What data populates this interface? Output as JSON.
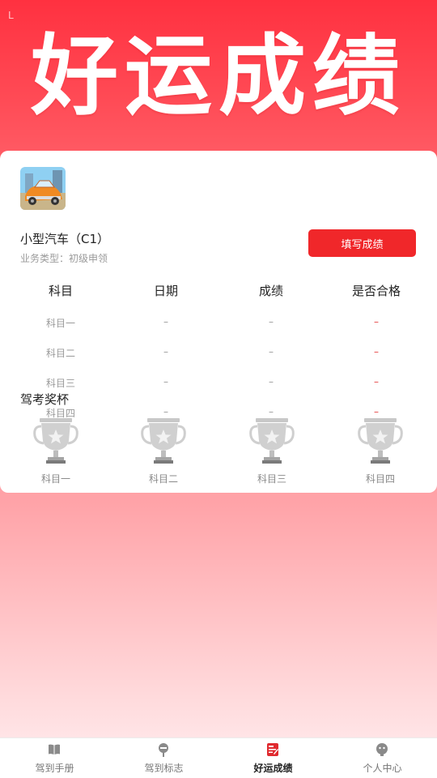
{
  "status": {
    "indicator": "L"
  },
  "hero": {
    "title": "好运成绩"
  },
  "license": {
    "title": "小型汽车（C1）",
    "business_type": "业务类型：初级申领",
    "fill_button": "填写成绩"
  },
  "table": {
    "headers": [
      "科目",
      "日期",
      "成绩",
      "是否合格"
    ],
    "rows": [
      {
        "subject": "科目一",
        "date": "–",
        "score": "–",
        "pass": "–"
      },
      {
        "subject": "科目二",
        "date": "–",
        "score": "–",
        "pass": "–"
      },
      {
        "subject": "科目三",
        "date": "–",
        "score": "–",
        "pass": "–"
      },
      {
        "subject": "科目四",
        "date": "–",
        "score": "–",
        "pass": "–"
      }
    ]
  },
  "trophies": {
    "title": "驾考奖杯",
    "items": [
      {
        "label": "科目一",
        "icon": "trophy-icon"
      },
      {
        "label": "科目二",
        "icon": "trophy-icon"
      },
      {
        "label": "科目三",
        "icon": "trophy-icon"
      },
      {
        "label": "科目四",
        "icon": "trophy-icon"
      }
    ]
  },
  "tabbar": {
    "tabs": [
      {
        "label": "驾到手册",
        "icon": "book-icon",
        "active": false
      },
      {
        "label": "驾到标志",
        "icon": "road-sign-icon",
        "active": false
      },
      {
        "label": "好运成绩",
        "icon": "score-report-icon",
        "active": true
      },
      {
        "label": "个人中心",
        "icon": "user-icon",
        "active": false
      }
    ]
  },
  "colors": {
    "primary": "#f0272a",
    "hero_bg": "#ff3140",
    "muted_text": "#9a9a9a",
    "fail_red": "#e54545"
  }
}
